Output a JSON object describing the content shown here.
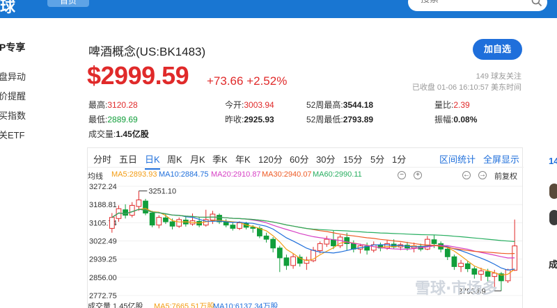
{
  "topbar": {
    "logo_text": "球",
    "home_label": "首页",
    "search_placeholder": "搜索"
  },
  "left_nav": {
    "title": "P专享",
    "items": [
      "盘异动",
      "价提醒",
      "买指数",
      "关ETF"
    ]
  },
  "stock": {
    "name": "啤酒概念(US:BK1483)",
    "follow_label": "加自选",
    "price": "$2999.59",
    "change": "+73.66 +2.52%",
    "followers": "149 球友关注",
    "status": "已收盘 01-06 16:10:57 美东时间"
  },
  "quote": [
    [
      {
        "label": "最高:",
        "value": "3120.28",
        "tone": "red"
      },
      {
        "label": "今开:",
        "value": "3003.94",
        "tone": "red"
      },
      {
        "label": "52周最高:",
        "value": "3544.18",
        "tone": "bold"
      },
      {
        "label": "量比:",
        "value": "2.39",
        "tone": "red"
      }
    ],
    [
      {
        "label": "最低:",
        "value": "2889.69",
        "tone": "green"
      },
      {
        "label": "昨收:",
        "value": "2925.93",
        "tone": "bold"
      },
      {
        "label": "52周最低:",
        "value": "2793.89",
        "tone": "bold"
      },
      {
        "label": "振幅:",
        "value": "0.08%",
        "tone": "bold"
      }
    ],
    [
      {
        "label": "成交量:",
        "value": "1.45亿股",
        "tone": "bold"
      }
    ]
  ],
  "chart_tabs": {
    "periods": [
      "分时",
      "五日",
      "日K",
      "周K",
      "月K",
      "季K",
      "年K",
      "120分",
      "60分",
      "30分",
      "15分",
      "5分",
      "1分"
    ],
    "active": "日K",
    "right_links": [
      "区间统计",
      "全屏显示"
    ]
  },
  "ma_line": {
    "label": "均线",
    "items": [
      {
        "text": "MA5:2893.93",
        "color": "#f39c12"
      },
      {
        "text": "MA10:2884.75",
        "color": "#1f6fdb"
      },
      {
        "text": "MA20:2910.87",
        "color": "#d63fc4"
      },
      {
        "text": "MA30:2940.07",
        "color": "#ee5a24"
      },
      {
        "text": "MA60:2990.11",
        "color": "#27ae60"
      }
    ],
    "controls": [
      "−",
      "+",
      "←",
      "→"
    ],
    "fuquan": "前复权"
  },
  "chart_data": {
    "type": "candlestick",
    "y_ticks": [
      "3272.24",
      "3188.81",
      "3105.74",
      "3022.49",
      "2939.25",
      "2856.00",
      "2772.75"
    ],
    "ylim": [
      2772.75,
      3272.24
    ],
    "annotations": {
      "high": "3251.10",
      "low": "2793.89"
    },
    "candles": [
      [
        3080,
        3130,
        3060,
        3150
      ],
      [
        3125,
        3170,
        3110,
        3185
      ],
      [
        3165,
        3140,
        3125,
        3190
      ],
      [
        3140,
        3185,
        3130,
        3200
      ],
      [
        3180,
        3210,
        3160,
        3251.1
      ],
      [
        3205,
        3150,
        3140,
        3215
      ],
      [
        3150,
        3095,
        3085,
        3160
      ],
      [
        3095,
        3130,
        3080,
        3140
      ],
      [
        3128,
        3110,
        3100,
        3145
      ],
      [
        3110,
        3090,
        3075,
        3125
      ],
      [
        3090,
        3120,
        3082,
        3130
      ],
      [
        3118,
        3100,
        3088,
        3135
      ],
      [
        3100,
        3115,
        3092,
        3148
      ],
      [
        3112,
        3095,
        3085,
        3130
      ],
      [
        3095,
        3120,
        3088,
        3165
      ],
      [
        3118,
        3145,
        3100,
        3160
      ],
      [
        3140,
        3110,
        3100,
        3148
      ],
      [
        3108,
        3095,
        3085,
        3122
      ],
      [
        3095,
        3080,
        3070,
        3105
      ],
      [
        3080,
        3105,
        3072,
        3112
      ],
      [
        3102,
        3085,
        3075,
        3110
      ],
      [
        3085,
        3080,
        3060,
        3095
      ],
      [
        3080,
        3045,
        3035,
        3090
      ],
      [
        3045,
        3030,
        3015,
        3060
      ],
      [
        3030,
        2990,
        2970,
        3040
      ],
      [
        2990,
        2945,
        2880,
        3000
      ],
      [
        2945,
        2910,
        2890,
        2960
      ],
      [
        2910,
        2950,
        2895,
        2965
      ],
      [
        2948,
        2920,
        2905,
        2960
      ],
      [
        2920,
        2935,
        2890,
        2950
      ],
      [
        2932,
        2980,
        2925,
        2995
      ],
      [
        2978,
        3010,
        2965,
        3020
      ],
      [
        3008,
        3030,
        2995,
        3045
      ],
      [
        3028,
        3000,
        2985,
        3070
      ],
      [
        3000,
        3040,
        2990,
        3050
      ],
      [
        3038,
        3010,
        2980,
        3060
      ],
      [
        3010,
        2985,
        2970,
        3025
      ],
      [
        2985,
        3000,
        2965,
        3010
      ],
      [
        2998,
        2980,
        2960,
        3015
      ],
      [
        2980,
        3005,
        2970,
        3020
      ],
      [
        3003,
        2990,
        2975,
        3015
      ],
      [
        2990,
        3010,
        2982,
        3025
      ],
      [
        3008,
        2995,
        2985,
        3030
      ],
      [
        2995,
        3005,
        2980,
        3015
      ],
      [
        3003,
        2990,
        2978,
        3018
      ],
      [
        2990,
        3000,
        2970,
        3015
      ],
      [
        2998,
        2985,
        2975,
        3010
      ],
      [
        2985,
        3030,
        2980,
        3045
      ],
      [
        3028,
        3010,
        2990,
        3050
      ],
      [
        3010,
        2985,
        2970,
        3020
      ],
      [
        2985,
        2950,
        2935,
        2995
      ],
      [
        2950,
        2905,
        2890,
        2960
      ],
      [
        2905,
        2920,
        2880,
        2935
      ],
      [
        2918,
        2895,
        2880,
        2930
      ],
      [
        2895,
        2870,
        2850,
        2905
      ],
      [
        2870,
        2885,
        2840,
        2900
      ],
      [
        2882,
        2860,
        2835,
        2895
      ],
      [
        2860,
        2875,
        2810,
        2890
      ],
      [
        2872,
        2840,
        2793.89,
        2880
      ],
      [
        2840,
        2890,
        2830,
        2895
      ],
      [
        2888,
        2999.59,
        2885,
        3120.28
      ]
    ]
  },
  "volume_line": {
    "label": "成交量 1.45亿股",
    "items": [
      {
        "text": "MA5:7665.51万股",
        "color": "#f39c12"
      },
      {
        "text": "MA10:6137.34万股",
        "color": "#1f6fdb"
      }
    ]
  },
  "watermark": "雪球·市场多",
  "right_strip": {
    "text1": "14",
    "text2": "成"
  }
}
